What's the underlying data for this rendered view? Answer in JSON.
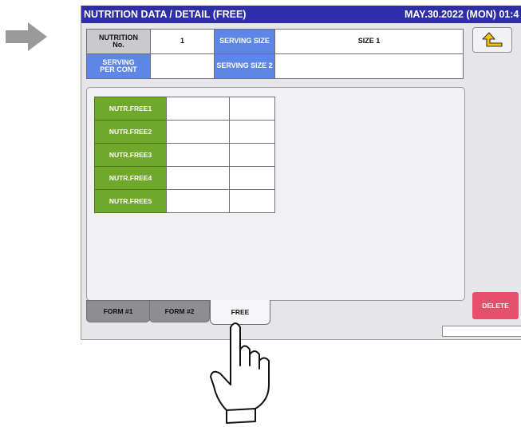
{
  "window": {
    "title": "NUTRITION DATA / DETAIL (FREE)",
    "datetime": "MAY.30.2022 (MON) 01:4"
  },
  "fields": {
    "nutrition_no_label": "NUTRITION\nNo.",
    "nutrition_no_value": "1",
    "serving_size_label": "SERVING SIZE",
    "serving_size_value": "SIZE 1",
    "serving_per_cont_label": "SERVING\nPER CONT",
    "serving_per_cont_value": "",
    "serving_size2_label": "SERVING SIZE 2",
    "serving_size2_value": ""
  },
  "nutr_free": {
    "items": [
      {
        "label": "NUTR.FREE1",
        "value": "",
        "unit": ""
      },
      {
        "label": "NUTR.FREE2",
        "value": "",
        "unit": ""
      },
      {
        "label": "NUTR.FREE3",
        "value": "",
        "unit": ""
      },
      {
        "label": "NUTR.FREE4",
        "value": "",
        "unit": ""
      },
      {
        "label": "NUTR.FREE5",
        "value": "",
        "unit": ""
      }
    ]
  },
  "tabs": [
    {
      "label": "FORM #1",
      "active": false
    },
    {
      "label": "FORM #2",
      "active": false
    },
    {
      "label": "FREE",
      "active": true
    }
  ],
  "buttons": {
    "delete_label": "DELETE"
  },
  "icons": {
    "instruction_arrow": "arrow-right-icon",
    "back": "return-arrow-icon",
    "pointer": "pointing-hand-icon"
  },
  "colors": {
    "title_bar": "#2e2fa8",
    "label_blue": "#5d86e6",
    "nutr_green": "#6fa82a",
    "delete_red": "#e6506a"
  }
}
